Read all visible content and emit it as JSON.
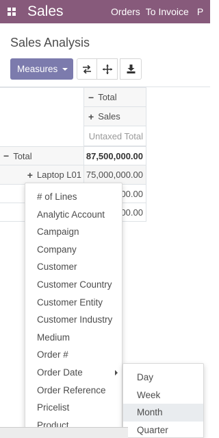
{
  "navbar": {
    "brand": "Sales",
    "menu": [
      "Orders",
      "To Invoice",
      "P"
    ]
  },
  "control_panel": {
    "title": "Sales Analysis",
    "measures_label": "Measures",
    "tools": [
      "flip-axis-icon",
      "expand-all-icon",
      "download-icon"
    ]
  },
  "pivot": {
    "col_header_total": "Total",
    "col_header_sales": "Sales",
    "measure_label": "Untaxed Total",
    "row_total_label": "Total",
    "row_total_value": "87,500,000.00",
    "row1_label": "Laptop L01",
    "row1_value": "75,000,000.00",
    "row2_value": "00.00",
    "row3_value": "00.00"
  },
  "groupby_menu": {
    "items": [
      "# of Lines",
      "Analytic Account",
      "Campaign",
      "Company",
      "Customer",
      "Customer Country",
      "Customer Entity",
      "Customer Industry",
      "Medium",
      "Order #",
      "Order Date",
      "Order Reference",
      "Pricelist",
      "Product"
    ]
  },
  "date_submenu": {
    "items": [
      "Day",
      "Week",
      "Month",
      "Quarter"
    ],
    "active": "Month"
  }
}
